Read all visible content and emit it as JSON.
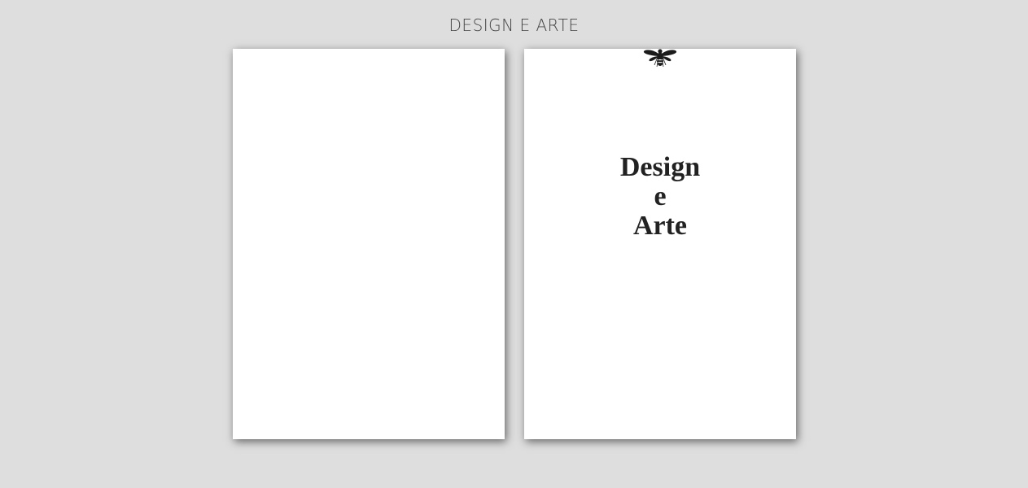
{
  "header": {
    "title": "DESIGN E ARTE"
  },
  "right_page": {
    "logo_icon": "bee-icon",
    "title_lines": [
      "Design",
      "e",
      "Arte"
    ]
  },
  "colors": {
    "background": "#dedede",
    "page": "#ffffff",
    "text": "#222222",
    "heading": "#454545"
  }
}
